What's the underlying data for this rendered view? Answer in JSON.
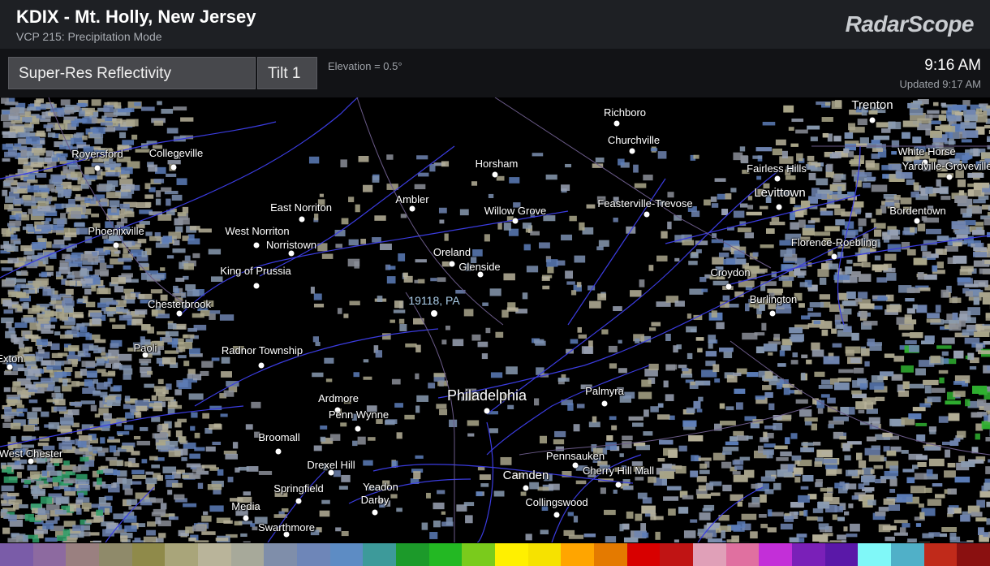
{
  "header": {
    "station_title": "KDIX - Mt. Holly, New Jersey",
    "vcp": "VCP 215: Precipitation Mode",
    "brand": "RadarScope"
  },
  "controls": {
    "product": "Super-Res Reflectivity",
    "tilt": "Tilt 1",
    "elevation": "Elevation = 0.5°",
    "time": "9:16 AM",
    "updated": "Updated 9:17 AM"
  },
  "map": {
    "current_location": "19118, PA",
    "places": [
      "Richboro",
      "Trenton",
      "Churchville",
      "White Horse",
      "Yardville-Groveville",
      "Royersford",
      "Collegeville",
      "Horsham",
      "Fairless Hills",
      "Levittown",
      "Ambler",
      "East Norriton",
      "Willow Grove",
      "Feasterville-Trevose",
      "Bordentown",
      "Phoenixville",
      "West Norriton",
      "Norristown",
      "Florence-Roebling",
      "Oreland",
      "Glenside",
      "King of Prussia",
      "Croydon",
      "Burlington",
      "Chesterbrook",
      "Paoli",
      "Radnor Township",
      "Exton",
      "Philadelphia",
      "Palmyra",
      "Ardmore",
      "Penn Wynne",
      "Broomall",
      "West Chester",
      "Pennsauken",
      "Drexel Hill",
      "Camden",
      "Cherry Hill Mall",
      "Springfield",
      "Yeadon",
      "Darby",
      "Collingswood",
      "Media",
      "Swarthmore"
    ]
  },
  "legend": {
    "colors": [
      "#7a5ca8",
      "#8d6aa0",
      "#9a8080",
      "#8f8a6a",
      "#8f8a4a",
      "#a9a57a",
      "#b9b49a",
      "#a7a99a",
      "#7f8eaa",
      "#6e86b8",
      "#5d8cc4",
      "#3d9a9a",
      "#1c9a2a",
      "#23b823",
      "#7acb1c",
      "#fff000",
      "#f6e200",
      "#ffa500",
      "#e47a00",
      "#d80000",
      "#c01414",
      "#e0a0b8",
      "#e070a0",
      "#c32fd8",
      "#7a20b8",
      "#5a18a8",
      "#80f8f8",
      "#50b0c8",
      "#c02a1a",
      "#8a1010"
    ]
  }
}
